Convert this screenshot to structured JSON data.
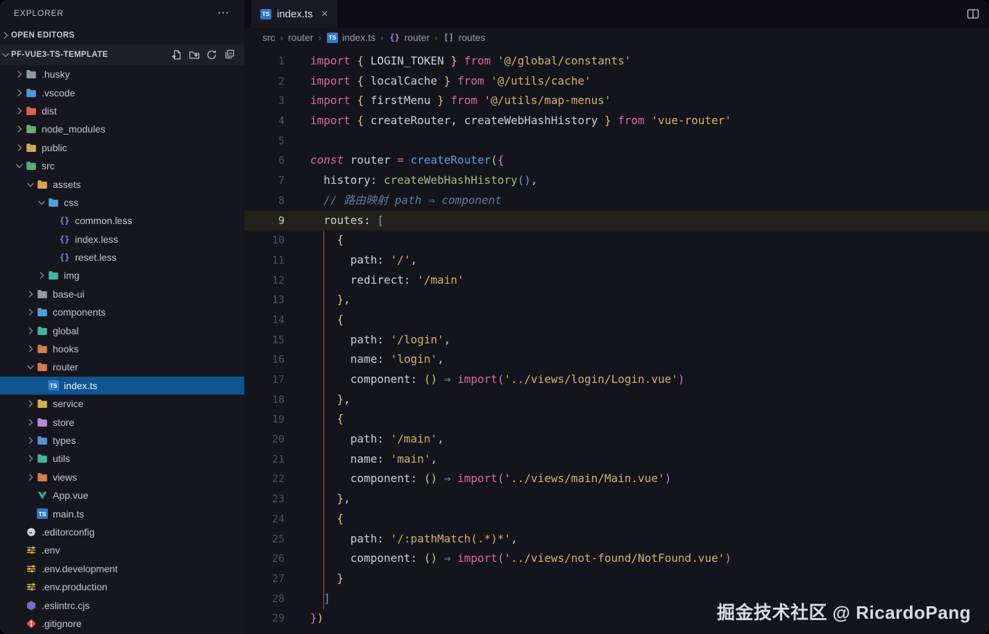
{
  "explorer": {
    "title": "EXPLORER",
    "more_icon": "⋯",
    "open_editors": {
      "label": "OPEN EDITORS",
      "expanded": false
    },
    "project": {
      "label": "PF-VUE3-TS-TEMPLATE",
      "expanded": true,
      "actions": [
        "new-file",
        "new-folder",
        "refresh",
        "collapse-all"
      ]
    },
    "tree": [
      {
        "label": ".husky",
        "depth": 1,
        "kind": "folder",
        "icon": "folder",
        "color": "#8e9aa6",
        "expanded": false
      },
      {
        "label": ".vscode",
        "depth": 1,
        "kind": "folder",
        "icon": "folder",
        "color": "#5494d6",
        "expanded": false
      },
      {
        "label": "dist",
        "depth": 1,
        "kind": "folder",
        "icon": "folder",
        "color": "#d95f50",
        "expanded": false
      },
      {
        "label": "node_modules",
        "depth": 1,
        "kind": "folder",
        "icon": "folder",
        "color": "#5fb36a",
        "expanded": false
      },
      {
        "label": "public",
        "depth": 1,
        "kind": "folder",
        "icon": "folder",
        "color": "#d8a35b",
        "expanded": false
      },
      {
        "label": "src",
        "depth": 1,
        "kind": "folder",
        "icon": "folder",
        "color": "#4caf7d",
        "expanded": true
      },
      {
        "label": "assets",
        "depth": 2,
        "kind": "folder",
        "icon": "folder",
        "color": "#dba24f",
        "expanded": true
      },
      {
        "label": "css",
        "depth": 3,
        "kind": "folder",
        "icon": "folder",
        "color": "#4aa3e0",
        "expanded": true
      },
      {
        "label": "common.less",
        "depth": 4,
        "kind": "file",
        "icon": "less"
      },
      {
        "label": "index.less",
        "depth": 4,
        "kind": "file",
        "icon": "less"
      },
      {
        "label": "reset.less",
        "depth": 4,
        "kind": "file",
        "icon": "less"
      },
      {
        "label": "img",
        "depth": 3,
        "kind": "folder",
        "icon": "folder",
        "color": "#45b3a0",
        "expanded": false
      },
      {
        "label": "base-ui",
        "depth": 2,
        "kind": "folder",
        "icon": "folder",
        "color": "#8e9aa6",
        "expanded": false
      },
      {
        "label": "components",
        "depth": 2,
        "kind": "folder",
        "icon": "folder",
        "color": "#4aa3e0",
        "expanded": false
      },
      {
        "label": "global",
        "depth": 2,
        "kind": "folder",
        "icon": "folder",
        "color": "#45b3a0",
        "expanded": false
      },
      {
        "label": "hooks",
        "depth": 2,
        "kind": "folder",
        "icon": "folder",
        "color": "#d87a4e",
        "expanded": false
      },
      {
        "label": "router",
        "depth": 2,
        "kind": "folder",
        "icon": "folder",
        "color": "#d87a4e",
        "expanded": true
      },
      {
        "label": "index.ts",
        "depth": 3,
        "kind": "file",
        "icon": "ts",
        "selected": true
      },
      {
        "label": "service",
        "depth": 2,
        "kind": "folder",
        "icon": "folder",
        "color": "#d3b04c",
        "expanded": false
      },
      {
        "label": "store",
        "depth": 2,
        "kind": "folder",
        "icon": "folder",
        "color": "#b78bd4",
        "expanded": false
      },
      {
        "label": "types",
        "depth": 2,
        "kind": "folder",
        "icon": "folder",
        "color": "#5494d6",
        "expanded": false
      },
      {
        "label": "utils",
        "depth": 2,
        "kind": "folder",
        "icon": "folder",
        "color": "#45b3a0",
        "expanded": false
      },
      {
        "label": "views",
        "depth": 2,
        "kind": "folder",
        "icon": "folder",
        "color": "#d87a4e",
        "expanded": false
      },
      {
        "label": "App.vue",
        "depth": 2,
        "kind": "file",
        "icon": "vue"
      },
      {
        "label": "main.ts",
        "depth": 2,
        "kind": "file",
        "icon": "ts"
      },
      {
        "label": ".editorconfig",
        "depth": 1,
        "kind": "file",
        "icon": "editorconfig"
      },
      {
        "label": ".env",
        "depth": 1,
        "kind": "file",
        "icon": "tune"
      },
      {
        "label": ".env.development",
        "depth": 1,
        "kind": "file",
        "icon": "tune"
      },
      {
        "label": ".env.production",
        "depth": 1,
        "kind": "file",
        "icon": "tune"
      },
      {
        "label": ".eslintrc.cjs",
        "depth": 1,
        "kind": "file",
        "icon": "eslint"
      },
      {
        "label": ".gitignore",
        "depth": 1,
        "kind": "file",
        "icon": "git"
      }
    ]
  },
  "tab": {
    "label": "index.ts",
    "close_icon": "×",
    "active": true
  },
  "breadcrumb": {
    "separator": "›",
    "items": [
      {
        "label": "src"
      },
      {
        "label": "router"
      },
      {
        "label": "index.ts",
        "icon": "ts"
      },
      {
        "label": "router",
        "icon": "symbol-namespace"
      },
      {
        "label": "routes",
        "icon": "symbol-array"
      }
    ]
  },
  "icons": {
    "ts_label": "TS"
  },
  "editor": {
    "language": "typescript",
    "active_line": 9,
    "lines": [
      [
        [
          "import ",
          "kw"
        ],
        [
          "{",
          "b1"
        ],
        [
          " LOGIN_TOKEN ",
          "pln"
        ],
        [
          "}",
          "b1"
        ],
        [
          " from ",
          "kw"
        ],
        [
          "'@/global/constants'",
          "str"
        ]
      ],
      [
        [
          "import ",
          "kw"
        ],
        [
          "{",
          "b1"
        ],
        [
          " localCache ",
          "pln"
        ],
        [
          "}",
          "b1"
        ],
        [
          " from ",
          "kw"
        ],
        [
          "'@/utils/cache'",
          "str"
        ]
      ],
      [
        [
          "import ",
          "kw"
        ],
        [
          "{",
          "b1"
        ],
        [
          " firstMenu ",
          "pln"
        ],
        [
          "}",
          "b1"
        ],
        [
          " from ",
          "kw"
        ],
        [
          "'@/utils/map-menus'",
          "str"
        ]
      ],
      [
        [
          "import ",
          "kw"
        ],
        [
          "{",
          "b1"
        ],
        [
          " createRouter, createWebHashHistory ",
          "pln"
        ],
        [
          "}",
          "b1"
        ],
        [
          " from ",
          "kw"
        ],
        [
          "'vue-router'",
          "str"
        ]
      ],
      [],
      [
        [
          "const ",
          "kwi"
        ],
        [
          "router ",
          "pln"
        ],
        [
          "= ",
          "kw"
        ],
        [
          "createRouter",
          "fnb"
        ],
        [
          "(",
          "b1"
        ],
        [
          "{",
          "b2"
        ]
      ],
      [
        [
          "  history",
          "pln"
        ],
        [
          ": ",
          "pln"
        ],
        [
          "createWebHashHistory",
          "fng"
        ],
        [
          "()",
          "b3"
        ],
        [
          ",",
          "pln"
        ]
      ],
      [
        [
          "  ",
          "pln"
        ],
        [
          "// 路由映射 path ⇒ component",
          "cm"
        ]
      ],
      [
        [
          "  routes",
          "pln"
        ],
        [
          ": ",
          "pln"
        ],
        [
          "[",
          "b3"
        ]
      ],
      [
        [
          "    ",
          "pln"
        ],
        [
          "{",
          "b1"
        ]
      ],
      [
        [
          "      path",
          "pln"
        ],
        [
          ": ",
          "pln"
        ],
        [
          "'/'",
          "str"
        ],
        [
          ",",
          "pln"
        ]
      ],
      [
        [
          "      redirect",
          "pln"
        ],
        [
          ": ",
          "pln"
        ],
        [
          "'/main'",
          "str"
        ]
      ],
      [
        [
          "    ",
          "pln"
        ],
        [
          "}",
          "b1"
        ],
        [
          ",",
          "pln"
        ]
      ],
      [
        [
          "    ",
          "pln"
        ],
        [
          "{",
          "b1"
        ]
      ],
      [
        [
          "      path",
          "pln"
        ],
        [
          ": ",
          "pln"
        ],
        [
          "'/login'",
          "str"
        ],
        [
          ",",
          "pln"
        ]
      ],
      [
        [
          "      name",
          "pln"
        ],
        [
          ": ",
          "pln"
        ],
        [
          "'login'",
          "str"
        ],
        [
          ",",
          "pln"
        ]
      ],
      [
        [
          "      component",
          "pln"
        ],
        [
          ": ",
          "pln"
        ],
        [
          "()",
          "b1"
        ],
        [
          " ",
          "pln"
        ],
        [
          "⇒",
          "arw"
        ],
        [
          " ",
          "pln"
        ],
        [
          "import",
          "kw"
        ],
        [
          "(",
          "b2"
        ],
        [
          "'../views/login/Login.vue'",
          "str"
        ],
        [
          ")",
          "b2"
        ]
      ],
      [
        [
          "    ",
          "pln"
        ],
        [
          "}",
          "b1"
        ],
        [
          ",",
          "pln"
        ]
      ],
      [
        [
          "    ",
          "pln"
        ],
        [
          "{",
          "b1"
        ]
      ],
      [
        [
          "      path",
          "pln"
        ],
        [
          ": ",
          "pln"
        ],
        [
          "'/main'",
          "str"
        ],
        [
          ",",
          "pln"
        ]
      ],
      [
        [
          "      name",
          "pln"
        ],
        [
          ": ",
          "pln"
        ],
        [
          "'main'",
          "str"
        ],
        [
          ",",
          "pln"
        ]
      ],
      [
        [
          "      component",
          "pln"
        ],
        [
          ": ",
          "pln"
        ],
        [
          "()",
          "b1"
        ],
        [
          " ",
          "pln"
        ],
        [
          "⇒",
          "arw"
        ],
        [
          " ",
          "pln"
        ],
        [
          "import",
          "kw"
        ],
        [
          "(",
          "b2"
        ],
        [
          "'../views/main/Main.vue'",
          "str"
        ],
        [
          ")",
          "b2"
        ]
      ],
      [
        [
          "    ",
          "pln"
        ],
        [
          "}",
          "b1"
        ],
        [
          ",",
          "pln"
        ]
      ],
      [
        [
          "    ",
          "pln"
        ],
        [
          "{",
          "b1"
        ]
      ],
      [
        [
          "      path",
          "pln"
        ],
        [
          ": ",
          "pln"
        ],
        [
          "'/:pathMatch(.*)*'",
          "str"
        ],
        [
          ",",
          "pln"
        ]
      ],
      [
        [
          "      component",
          "pln"
        ],
        [
          ": ",
          "pln"
        ],
        [
          "()",
          "b1"
        ],
        [
          " ",
          "pln"
        ],
        [
          "⇒",
          "arw"
        ],
        [
          " ",
          "pln"
        ],
        [
          "import",
          "kw"
        ],
        [
          "(",
          "b2"
        ],
        [
          "'../views/not-found/NotFound.vue'",
          "str"
        ],
        [
          ")",
          "b2"
        ]
      ],
      [
        [
          "    ",
          "pln"
        ],
        [
          "}",
          "b1"
        ]
      ],
      [
        [
          "  ",
          "pln"
        ],
        [
          "]",
          "b3"
        ]
      ],
      [
        [
          "}",
          "b2"
        ],
        [
          ")",
          "b1"
        ]
      ]
    ]
  },
  "watermark": "掘金技术社区 @ RicardoPang",
  "colors": {
    "editor_bg": "#14141c",
    "sidebar_bg": "#16161e",
    "tabstrip_bg": "#0d0d13",
    "selection_blue": "#0e5490",
    "active_line_bg": "#22221a",
    "active_indent_guide": "#b95c50",
    "keyword_pink": "#d86b9d",
    "string_yellow": "#d1b26e",
    "function_blue": "#5ca0e8",
    "function_green": "#98c379",
    "comment_blue": "#5f7d96",
    "bracket_gold": "#dcc179",
    "bracket_purple": "#c77dd6",
    "bracket_blue": "#6c9fd8",
    "ts_badge_blue": "#3179c7"
  }
}
